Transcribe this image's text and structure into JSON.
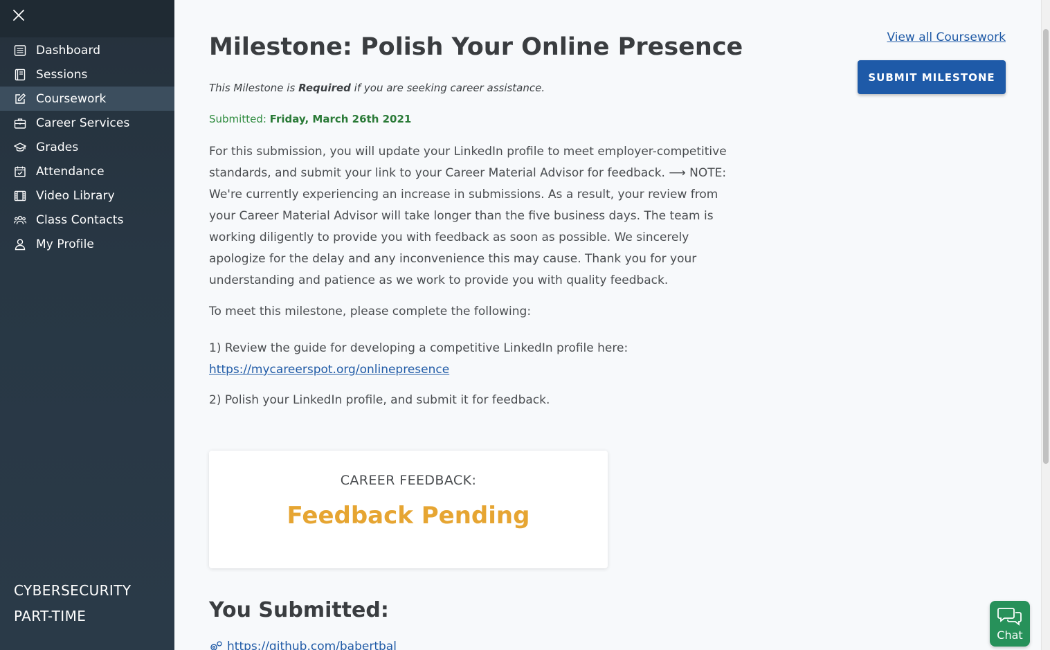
{
  "sidebar": {
    "items": [
      {
        "label": "Dashboard",
        "icon": "list-icon"
      },
      {
        "label": "Sessions",
        "icon": "book-icon"
      },
      {
        "label": "Coursework",
        "icon": "edit-icon"
      },
      {
        "label": "Career Services",
        "icon": "briefcase-icon"
      },
      {
        "label": "Grades",
        "icon": "graduation-cap-icon"
      },
      {
        "label": "Attendance",
        "icon": "calendar-check-icon"
      },
      {
        "label": "Video Library",
        "icon": "film-icon"
      },
      {
        "label": "Class Contacts",
        "icon": "users-icon"
      },
      {
        "label": "My Profile",
        "icon": "user-icon"
      }
    ],
    "active": "Coursework",
    "program_line1": "CYBERSECURITY",
    "program_line2": "PART-TIME"
  },
  "main": {
    "title": "Milestone: Polish Your Online Presence",
    "view_all": "View all Coursework",
    "submit_button": "SUBMIT MILESTONE",
    "required_pre": "This Milestone is ",
    "required_bold": "Required",
    "required_post": " if you are seeking career assistance.",
    "submitted_label": "Submitted: ",
    "submitted_date": "Friday, March 26th 2021",
    "description": "For this submission, you will update your LinkedIn profile to meet employer-competitive standards, and submit your link to your Career Material Advisor for feedback. ⟶ NOTE: We're currently experiencing an increase in submissions. As a result, your review from your Career Material Advisor will take longer than the five business days. The team is working diligently to provide you with feedback as soon as possible. We sincerely apologize for the delay and any inconvenience this may cause. Thank you for your understanding and patience as we work to provide you with quality feedback.",
    "instructions_intro": "To meet this milestone, please complete the following:",
    "step1_text": "1) Review the guide for developing a competitive LinkedIn profile here:",
    "step1_link": "https://mycareerspot.org/onlinepresence",
    "step2_text": "2) Polish your LinkedIn profile, and submit it for feedback.",
    "feedback_label": "CAREER FEEDBACK:",
    "feedback_status": "Feedback Pending",
    "you_submitted": "You Submitted:",
    "submitted_link": "https://github.com/babertbal"
  },
  "chat": {
    "label": "Chat"
  },
  "colors": {
    "sidebar_bg": "#283744",
    "accent_blue": "#1e5aa8",
    "submitted_green": "#2e8b3e",
    "pending_orange": "#e6a532",
    "chat_green": "#27915a"
  }
}
